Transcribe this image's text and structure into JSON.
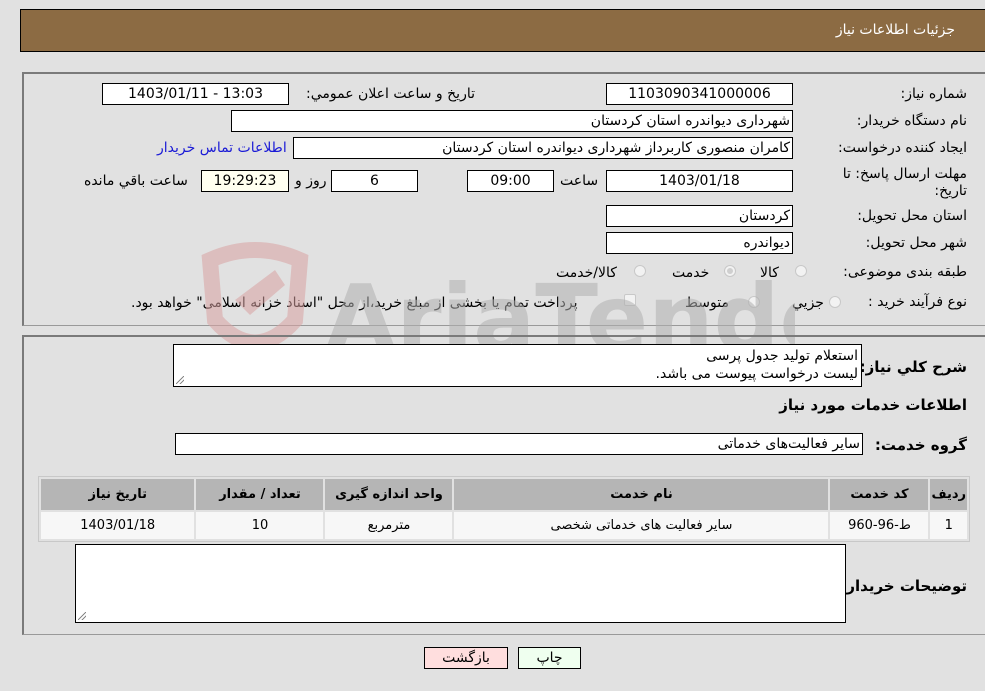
{
  "header": {
    "title": "جزئیات اطلاعات نیاز"
  },
  "form": {
    "need_number": {
      "label": "شماره نیاز:",
      "value": "1103090341000006"
    },
    "announce_datetime": {
      "label": "تاریخ و ساعت اعلان عمومي:",
      "value": "1403/01/11 - 13:03"
    },
    "buyer_org": {
      "label": "نام دستگاه خريدار:",
      "value": "شهرداری دیواندره استان کردستان"
    },
    "requester": {
      "label": "ايجاد كننده درخواست:",
      "value": "کامران منصوری کاربرداز شهرداری دیواندره استان کردستان"
    },
    "buyer_contact_link": "اطلاعات تماس خريدار",
    "deadline": {
      "label_line1": "مهلت ارسال پاسخ: تا",
      "label_line2": "تاریخ:",
      "date": "1403/01/18",
      "time_label": "ساعت",
      "time": "09:00",
      "days": "6",
      "days_label": "روز و",
      "remaining": "19:29:23",
      "remaining_label": "ساعت باقي مانده"
    },
    "delivery_province": {
      "label": "استان محل تحویل:",
      "value": "کردستان"
    },
    "delivery_city": {
      "label": "شهر محل تحویل:",
      "value": "دیواندره"
    },
    "category": {
      "label": "طبقه بندی موضوعی:",
      "options": [
        "کالا",
        "خدمت",
        "کالا/خدمت"
      ],
      "selected": "خدمت"
    },
    "purchase_type": {
      "label": "نوع فرآیند خرید :",
      "options": [
        "جزيي",
        "متوسط"
      ],
      "treasury_note": "پرداخت تمام یا بخشی از مبلغ خرید،از محل \"اسناد خزانه اسلامی\" خواهد بود."
    }
  },
  "details": {
    "description_label": "شرح کلي نياز:",
    "description_line1": "استعلام تولید جدول پرسی",
    "description_line2": "لیست درخواست پیوست می باشد.",
    "services_heading": "اطلاعات خدمات مورد نياز",
    "service_group_label": "گروه خدمت:",
    "service_group_value": "سایر فعالیت‌های خدماتی",
    "table": {
      "headers": [
        "رديف",
        "كد خدمت",
        "نام خدمت",
        "واحد اندازه گيری",
        "تعداد / مقدار",
        "تاريخ نياز"
      ],
      "rows": [
        [
          "1",
          "ط-96-960",
          "سایر فعالیت های خدماتی شخصی",
          "مترمربع",
          "10",
          "1403/01/18"
        ]
      ]
    },
    "buyer_notes_label": "توضيحات خريدار:",
    "buyer_notes_value": ""
  },
  "buttons": {
    "print": "چاپ",
    "back": "بازگشت"
  },
  "colors": {
    "header_bg": "#8c6b43",
    "print_bg": "#efffef",
    "back_bg": "#ffdede",
    "link": "#1a1ad6"
  },
  "watermark": {
    "text": "AriaTender.neT"
  }
}
